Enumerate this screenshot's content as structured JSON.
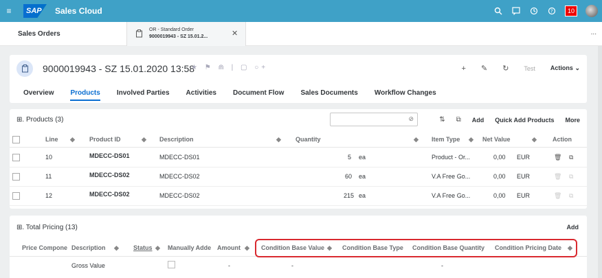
{
  "shell": {
    "app_title": "Sales Cloud",
    "logo_text": "SAP",
    "notification_count": "10",
    "icons": [
      "menu-icon",
      "search-icon",
      "feedback-icon",
      "history-icon",
      "help-icon",
      "notifications-icon",
      "avatar"
    ]
  },
  "tabs": {
    "sales_orders": "Sales Orders",
    "doc_line1": "OR - Standard Order",
    "doc_line2": "9000019943 - SZ 15.01.2...",
    "more": "..."
  },
  "header": {
    "title": "9000019943 - SZ 15.01.2020 13:58",
    "test_label": "Test",
    "actions_label": "Actions",
    "nav": [
      "Overview",
      "Products",
      "Involved Parties",
      "Activities",
      "Document Flow",
      "Sales Documents",
      "Workflow Changes"
    ],
    "active_nav": "Products"
  },
  "products": {
    "title": "Products",
    "count": "(3)",
    "add_label": "Add",
    "quick_add_label": "Quick Add Products",
    "more_label": "More",
    "columns": [
      "Line",
      "Product ID",
      "Description",
      "Quantity",
      "Item Type",
      "Net Value",
      "Action"
    ],
    "rows": [
      {
        "line": "10",
        "product_id": "MDECC-DS01",
        "description": "MDECC-DS01",
        "qty": "5",
        "uom": "ea",
        "item_type": "Product - Or...",
        "net": "0,00",
        "cur": "EUR"
      },
      {
        "line": "11",
        "product_id": "MDECC-DS02",
        "description": "MDECC-DS02",
        "qty": "60",
        "uom": "ea",
        "item_type": "V.A Free Go...",
        "net": "0,00",
        "cur": "EUR"
      },
      {
        "line": "12",
        "product_id": "MDECC-DS02",
        "description": "MDECC-DS02",
        "qty": "215",
        "uom": "ea",
        "item_type": "V.A Free Go...",
        "net": "0,00",
        "cur": "EUR"
      }
    ]
  },
  "pricing": {
    "title": "Total Pricing",
    "count": "(13)",
    "add_label": "Add",
    "columns": [
      "Price Compone",
      "Description",
      "Status",
      "Manually Adde",
      "Amount",
      "Condition Base Value",
      "Condition Base Type",
      "Condition Base Quantity",
      "Condition Pricing Date"
    ],
    "row": {
      "description": "Gross Value",
      "amount": "-",
      "base_value": "-",
      "base_qty": "-"
    }
  }
}
